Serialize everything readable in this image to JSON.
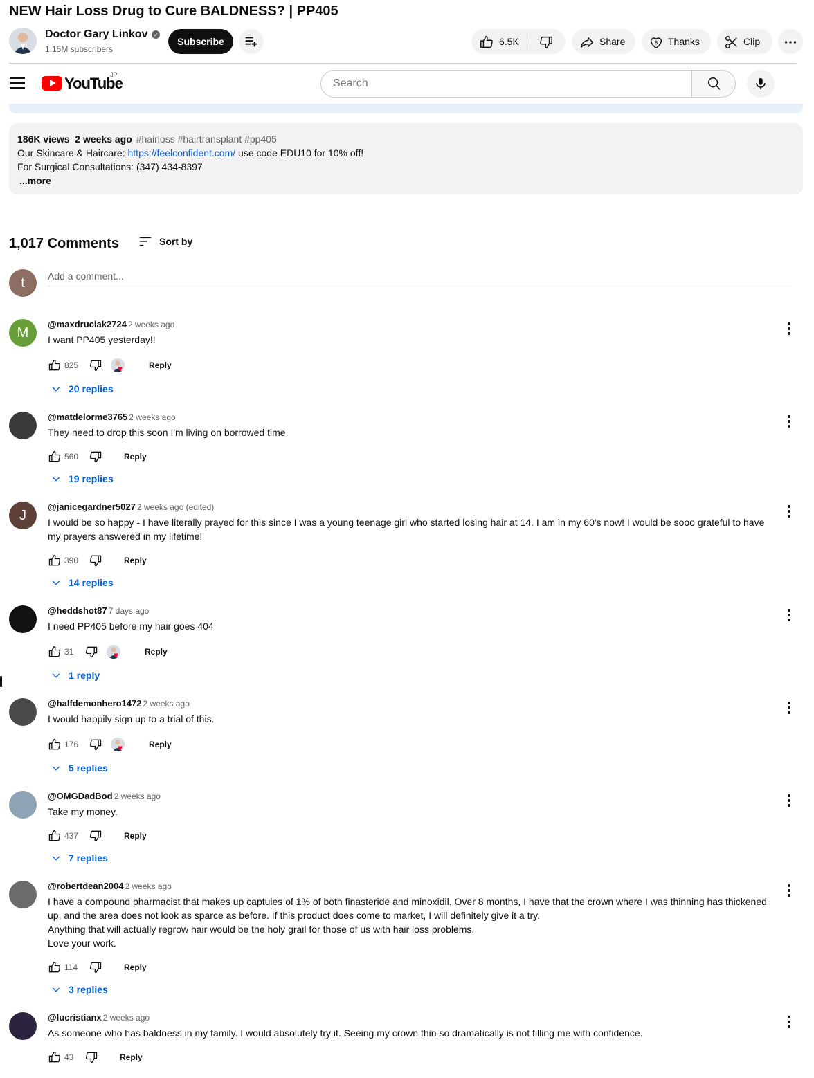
{
  "video": {
    "title": "NEW Hair Loss Drug to Cure BALDNESS? | PP405"
  },
  "channel": {
    "name": "Doctor Gary Linkov",
    "subscribers": "1.15M subscribers",
    "subscribe_label": "Subscribe"
  },
  "actions": {
    "likes": "6.5K",
    "share_label": "Share",
    "thanks_label": "Thanks",
    "clip_label": "Clip"
  },
  "masthead": {
    "logo_text": "YouTube",
    "country_code": "JP",
    "search_placeholder": "Search"
  },
  "description": {
    "views": "186K views",
    "date": "2 weeks ago",
    "tags": "#hairloss #hairtransplant #pp405",
    "line1_prefix": "Our Skincare & Haircare: ",
    "line1_link": "https://feelconfident.com/",
    "line1_suffix": " use code EDU10 for 10% off!",
    "line2": "For Surgical Consultations: (347) 434-8397",
    "more_label": "...more"
  },
  "comments_section": {
    "count_label": "1,017 Comments",
    "sort_label": "Sort by",
    "add_placeholder": "Add a comment...",
    "my_avatar_letter": "t",
    "reply_label": "Reply",
    "items": [
      {
        "author": "@maxdruciak2724",
        "time": "2 weeks ago",
        "text": "I want PP405 yesterday!!",
        "likes": "825",
        "hearted": true,
        "replies": "20 replies",
        "avatar_letter": "M",
        "avatar_color": "#689f38"
      },
      {
        "author": "@matdelorme3765",
        "time": "2 weeks ago",
        "text": "They need to drop this soon I'm living on borrowed time",
        "likes": "560",
        "hearted": false,
        "replies": "19 replies",
        "avatar_letter": "",
        "avatar_color": "#3a3a3a"
      },
      {
        "author": "@janicegardner5027",
        "time": "2 weeks ago (edited)",
        "text": "I would be so happy - I have literally prayed for this since I was a young teenage girl who started losing hair at 14.  I am in my 60's now!  I would be sooo grateful to have my prayers answered in my lifetime!",
        "likes": "390",
        "hearted": false,
        "replies": "14 replies",
        "avatar_letter": "J",
        "avatar_color": "#5d4037"
      },
      {
        "author": "@heddshot87",
        "time": "7 days ago",
        "text": "I need PP405 before my hair goes 404",
        "likes": "31",
        "hearted": true,
        "replies": "1 reply",
        "avatar_letter": "",
        "avatar_color": "#111111"
      },
      {
        "author": "@halfdemonhero1472",
        "time": "2 weeks ago",
        "text": "I would happily sign up to a trial of this.",
        "likes": "176",
        "hearted": true,
        "replies": "5 replies",
        "avatar_letter": "",
        "avatar_color": "#4a4a4a"
      },
      {
        "author": "@OMGDadBod",
        "time": "2 weeks ago",
        "text": "Take my money.",
        "likes": "437",
        "hearted": false,
        "replies": "7 replies",
        "avatar_letter": "",
        "avatar_color": "#8ea3b5"
      },
      {
        "author": "@robertdean2004",
        "time": "2 weeks ago",
        "text": "I have a compound pharmacist that makes up captules of 1% of both finasteride and minoxidil. Over 8 months, I have that the crown where I was thinning has thickened up, and the area does not look as sparce as before. If this product does come to market, I will definitely give it a try.\nAnything that will actually regrow hair would be the holy grail for those of us with hair loss problems.\nLove your work.",
        "likes": "114",
        "hearted": false,
        "replies": "3 replies",
        "avatar_letter": "",
        "avatar_color": "#6b6b6b"
      },
      {
        "author": "@lucristianx",
        "time": "2 weeks ago",
        "text": "As someone who has baldness in my family. I would absolutely try it. Seeing my crown thin so dramatically is not filling me with confidence.",
        "likes": "43",
        "hearted": false,
        "replies": "",
        "avatar_letter": "",
        "avatar_color": "#2c2340"
      }
    ]
  },
  "colors": {
    "link": "#065fd4",
    "heart": "#ff0033",
    "subscribe_bg": "#0f0f0f"
  }
}
